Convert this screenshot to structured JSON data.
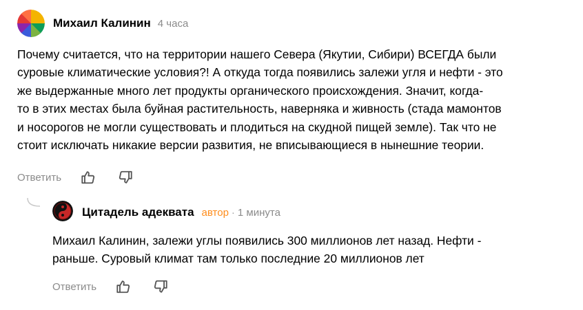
{
  "comment": {
    "author": "Михаил Калинин",
    "time": "4 часа",
    "text_lines": [
      "Почему считается, что на территории нашего Севера (Якутии, Сибири) ВСЕГДА были",
      "суровые климатические условия?! А откуда тогда появились залежи угля и нефти - это",
      "же выдержанные много лет продукты органического происхождения. Значит, когда-",
      "то в этих местах была буйная растительность, наверняка и живность (стада мамонтов",
      "и носорогов не могли существовать и плодиться на скудной пищей земле). Так что не",
      "стоит исключать никакие версии развития, не вписывающиеся в нынешние теории."
    ],
    "reply_label": "Ответить",
    "icons": {
      "like": "thumbs-up-icon",
      "dislike": "thumbs-down-icon",
      "avatar": "multicolor-circle-avatar"
    }
  },
  "reply": {
    "author": "Цитадель адеквата",
    "badge": "автор",
    "separator": "·",
    "time": "1 минута",
    "text_lines": [
      "Михаил Калинин, залежи углы появились 300 миллионов лет назад. Нефти -",
      "раньше. Суровый климат там только последние 20 миллионов лет"
    ],
    "reply_label": "Ответить",
    "icons": {
      "like": "thumbs-up-icon",
      "dislike": "thumbs-down-icon",
      "avatar": "yin-yang-avatar"
    }
  },
  "colors": {
    "text": "#000000",
    "muted": "#8a8a8a",
    "author_badge": "#ff8c1a"
  }
}
